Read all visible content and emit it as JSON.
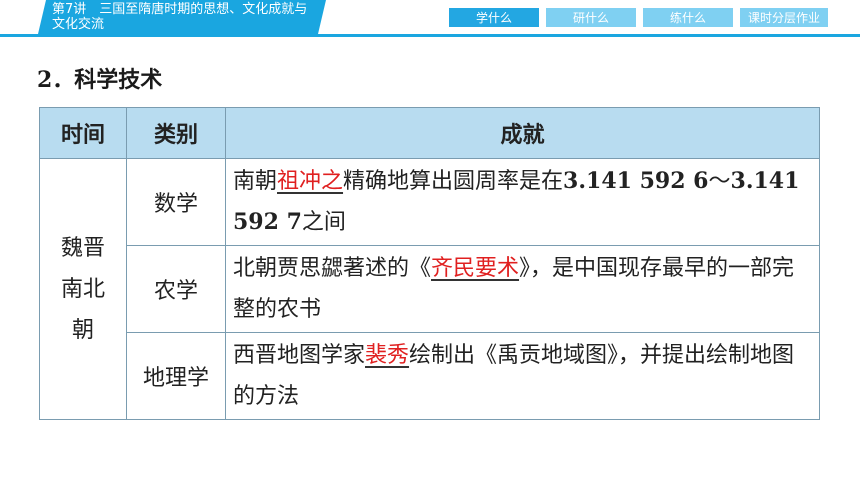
{
  "header": {
    "lesson_title": "第7讲　三国至隋唐时期的思想、文化成就与文化交流",
    "nav": [
      "学什么",
      "研什么",
      "练什么",
      "课时分层作业"
    ]
  },
  "section_title": "2．科学技术",
  "table": {
    "headers": [
      "时间",
      "类别",
      "成就"
    ],
    "era": [
      "魏晋",
      "南北",
      "朝"
    ],
    "rows": [
      {
        "category": "数学",
        "pre": "南朝",
        "highlight": "祖冲之",
        "post": "精确地算出圆周率是在",
        "num1": "3.141 592 6",
        "sep": "～",
        "num2": "3.141 592 7",
        "end": "之间"
      },
      {
        "category": "农学",
        "pre": "北朝贾思勰著述的《",
        "highlight": "齐民要术",
        "post": "》，是中国现存最早的一部完整的农书"
      },
      {
        "category": "地理学",
        "pre": "西晋地图学家",
        "highlight": "裴秀",
        "post": "绘制出《禹贡地域图》，并提出绘制地图的方法"
      }
    ]
  }
}
